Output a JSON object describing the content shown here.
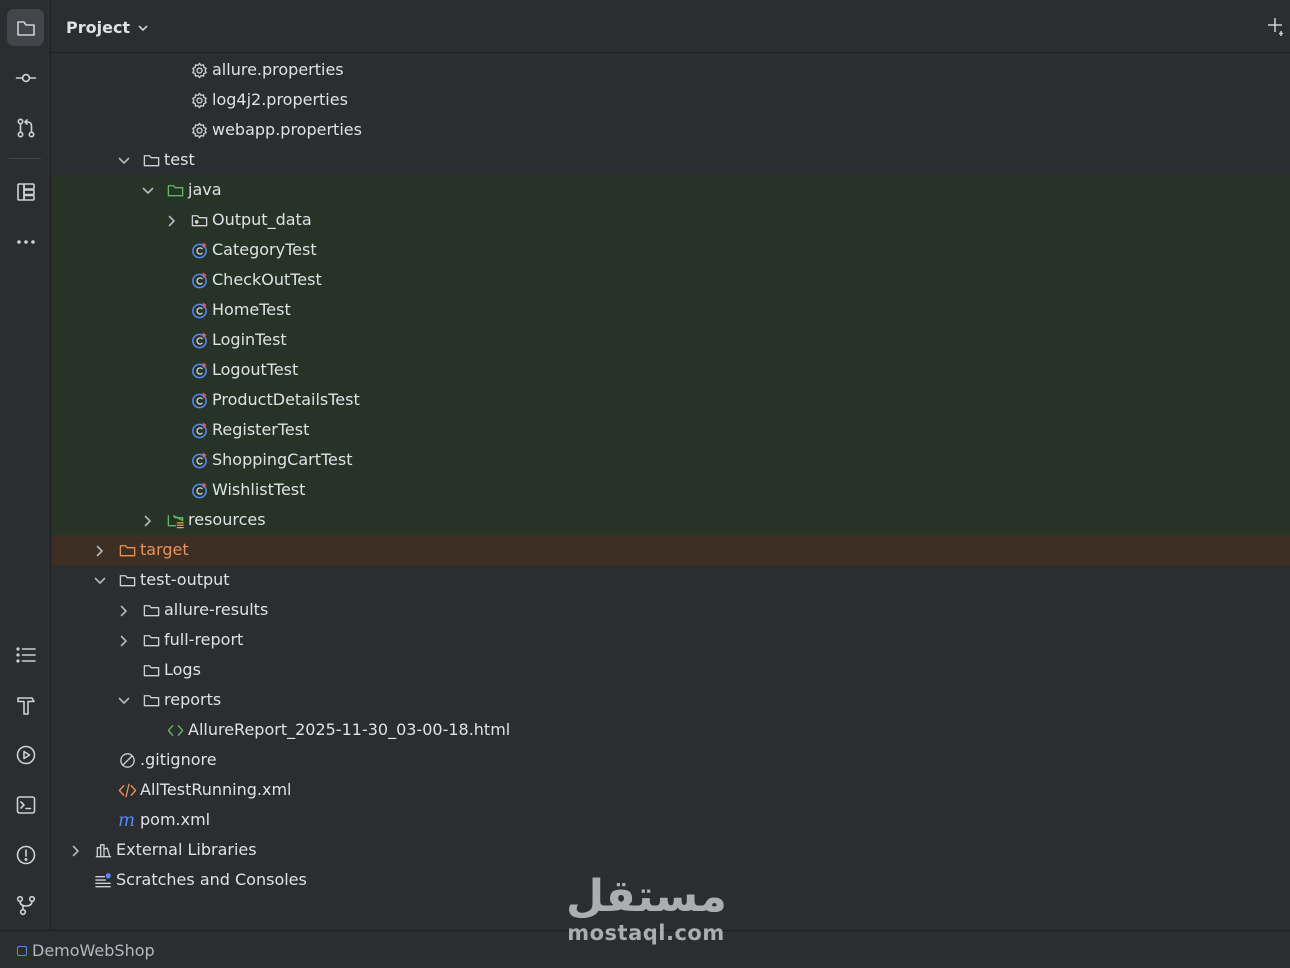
{
  "panel": {
    "title": "Project"
  },
  "colors": {
    "background": "#2b2d30",
    "test_root_highlight": "#283328",
    "excluded_highlight": "#3d2f23",
    "text": "#dfe1e5",
    "excluded_text": "#e8925a",
    "class_icon": "#548af7",
    "maven_icon": "#548af7"
  },
  "sidebar": {
    "top": [
      {
        "icon": "folder-icon",
        "active": true
      },
      {
        "icon": "commit-icon"
      },
      {
        "icon": "pull-request-icon"
      },
      {
        "icon": "structure-icon"
      },
      {
        "icon": "more-icon"
      }
    ],
    "bottom": [
      {
        "icon": "todo-list-icon"
      },
      {
        "icon": "build-hammer-icon"
      },
      {
        "icon": "services-icon"
      },
      {
        "icon": "terminal-icon"
      },
      {
        "icon": "problems-icon"
      },
      {
        "icon": "git-branch-icon"
      }
    ]
  },
  "tree": [
    {
      "label": "allure.properties",
      "icon": "properties-icon",
      "level": 5,
      "chevron": "none"
    },
    {
      "label": "log4j2.properties",
      "icon": "properties-icon",
      "level": 5,
      "chevron": "none"
    },
    {
      "label": "webapp.properties",
      "icon": "properties-icon",
      "level": 5,
      "chevron": "none"
    },
    {
      "label": "test",
      "icon": "folder-icon",
      "level": 3,
      "chevron": "down"
    },
    {
      "label": "java",
      "icon": "test-source-folder-icon",
      "level": 4,
      "chevron": "down",
      "highlight": "green"
    },
    {
      "label": "Output_data",
      "icon": "package-icon",
      "level": 5,
      "chevron": "right",
      "highlight": "green"
    },
    {
      "label": "CategoryTest",
      "icon": "java-test-class-icon",
      "level": 5,
      "chevron": "none",
      "highlight": "green"
    },
    {
      "label": "CheckOutTest",
      "icon": "java-test-class-icon",
      "level": 5,
      "chevron": "none",
      "highlight": "green"
    },
    {
      "label": "HomeTest",
      "icon": "java-test-class-icon",
      "level": 5,
      "chevron": "none",
      "highlight": "green"
    },
    {
      "label": "LoginTest",
      "icon": "java-test-class-icon",
      "level": 5,
      "chevron": "none",
      "highlight": "green"
    },
    {
      "label": "LogoutTest",
      "icon": "java-test-class-icon",
      "level": 5,
      "chevron": "none",
      "highlight": "green"
    },
    {
      "label": "ProductDetailsTest",
      "icon": "java-test-class-icon",
      "level": 5,
      "chevron": "none",
      "highlight": "green"
    },
    {
      "label": "RegisterTest",
      "icon": "java-test-class-icon",
      "level": 5,
      "chevron": "none",
      "highlight": "green"
    },
    {
      "label": "ShoppingCartTest",
      "icon": "java-test-class-icon",
      "level": 5,
      "chevron": "none",
      "highlight": "green"
    },
    {
      "label": "WishlistTest",
      "icon": "java-test-class-icon",
      "level": 5,
      "chevron": "none",
      "highlight": "green"
    },
    {
      "label": "resources",
      "icon": "test-resources-folder-icon",
      "level": 4,
      "chevron": "right",
      "highlight": "green"
    },
    {
      "label": "target",
      "icon": "excluded-folder-icon",
      "level": 2,
      "chevron": "right",
      "highlight": "orange"
    },
    {
      "label": "test-output",
      "icon": "folder-icon",
      "level": 2,
      "chevron": "down"
    },
    {
      "label": "allure-results",
      "icon": "folder-icon",
      "level": 3,
      "chevron": "right"
    },
    {
      "label": "full-report",
      "icon": "folder-icon",
      "level": 3,
      "chevron": "right"
    },
    {
      "label": "Logs",
      "icon": "folder-icon",
      "level": 3,
      "chevron": "none"
    },
    {
      "label": "reports",
      "icon": "folder-icon",
      "level": 3,
      "chevron": "down"
    },
    {
      "label": "AllureReport_2025-11-30_03-00-18.html",
      "icon": "html-file-icon",
      "level": 4,
      "chevron": "none"
    },
    {
      "label": ".gitignore",
      "icon": "ignore-file-icon",
      "level": 2,
      "chevron": "none"
    },
    {
      "label": "AllTestRunning.xml",
      "icon": "xml-file-icon",
      "level": 2,
      "chevron": "none"
    },
    {
      "label": "pom.xml",
      "icon": "maven-icon",
      "level": 2,
      "chevron": "none"
    },
    {
      "label": "External Libraries",
      "icon": "libraries-icon",
      "level": 1,
      "chevron": "right"
    },
    {
      "label": "Scratches and Consoles",
      "icon": "scratches-icon",
      "level": 1,
      "chevron": "none"
    }
  ],
  "statusbar": {
    "project": "DemoWebShop"
  },
  "watermark": {
    "arabic": "مستقل",
    "latin": "mostaql.com"
  }
}
